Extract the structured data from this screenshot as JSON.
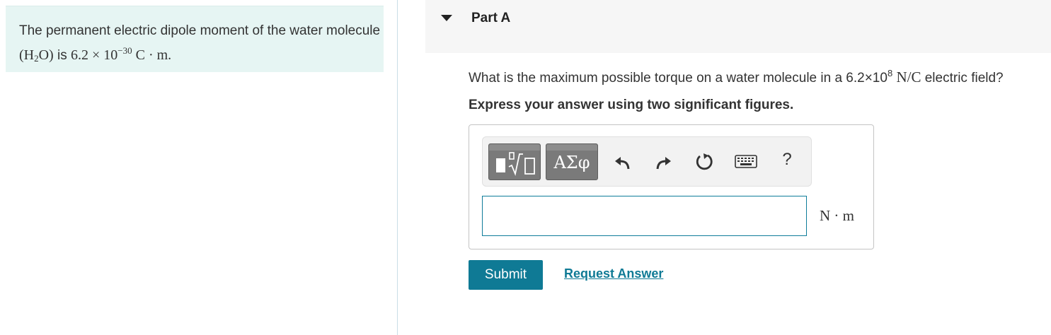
{
  "problem": {
    "text_before": "The permanent electric dipole moment of the water molecule ",
    "molecule_open": "(H",
    "molecule_sub": "2",
    "molecule_close": "O)",
    "text_is": " is ",
    "value_base": "6.2 × 10",
    "value_exp": "−30",
    "value_unit": " C · m."
  },
  "part": {
    "title": "Part A"
  },
  "question": {
    "text_before": "What is the maximum possible torque on a water molecule in a 6.2×10",
    "exp": "8",
    "unit": " N/C",
    "text_after": " electric field?"
  },
  "instruction": "Express your answer using two significant figures.",
  "toolbar": {
    "templates_icon": "templates-icon",
    "symbols_label": "ΑΣφ",
    "undo_icon": "undo-icon",
    "redo_icon": "redo-icon",
    "reset_icon": "reset-icon",
    "keyboard_icon": "keyboard-icon",
    "help_label": "?"
  },
  "answer": {
    "value": "",
    "placeholder": "",
    "unit": "N · m"
  },
  "actions": {
    "submit_label": "Submit",
    "request_label": "Request Answer"
  },
  "colors": {
    "accent": "#0f7a95",
    "problem_bg": "#e6f5f3",
    "header_bg": "#f6f6f6",
    "template_btn": "#7a7a7a"
  }
}
